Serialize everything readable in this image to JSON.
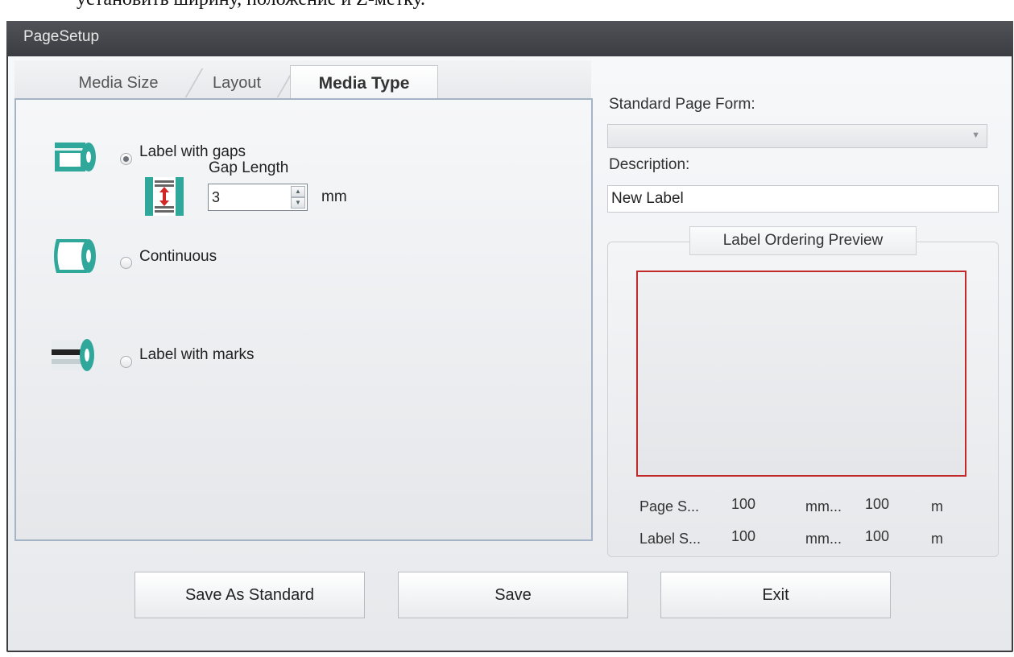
{
  "doc_fragment": "установить ширину, положение и Z-метку.",
  "window": {
    "title": "PageSetup"
  },
  "tabs": [
    {
      "label": "Media Size",
      "active": false
    },
    {
      "label": "Layout",
      "active": false
    },
    {
      "label": "Media Type",
      "active": true
    }
  ],
  "media_type": {
    "options": [
      {
        "label": "Label with gaps",
        "checked": true,
        "icon": "label-gaps-roll-icon"
      },
      {
        "label": "Continuous",
        "checked": false,
        "icon": "continuous-roll-icon"
      },
      {
        "label": "Label with marks",
        "checked": false,
        "icon": "label-marks-roll-icon"
      }
    ],
    "gap_length": {
      "label": "Gap Length",
      "value": "3",
      "unit": "mm",
      "icon": "gap-length-icon"
    }
  },
  "right_panel": {
    "standard_form_label": "Standard Page Form:",
    "standard_form_value": "",
    "description_label": "Description:",
    "description_value": "New Label",
    "preview_title": "Label Ordering Preview",
    "page_size": {
      "label": "Page S...",
      "width": "100",
      "unit1": "mm...",
      "height": "100",
      "unit2": "m"
    },
    "label_size": {
      "label": "Label S...",
      "width": "100",
      "unit1": "mm...",
      "height": "100",
      "unit2": "m"
    }
  },
  "buttons": {
    "save_as_standard": "Save As Standard",
    "save": "Save",
    "exit": "Exit"
  },
  "colors": {
    "accent_teal": "#2fa79a",
    "preview_border": "#c22a2a",
    "titlebar": "#45474c"
  }
}
